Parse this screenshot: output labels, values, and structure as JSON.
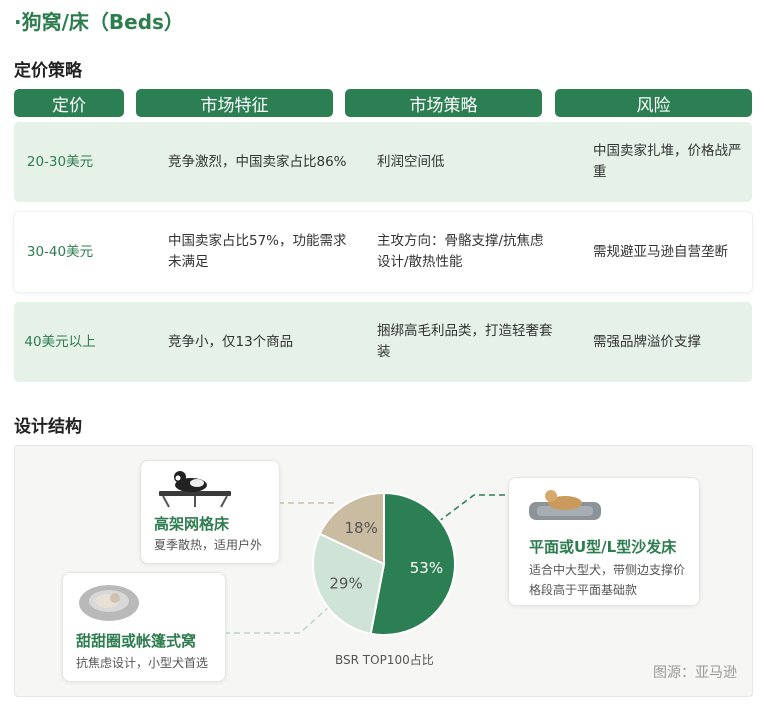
{
  "page_title": "·狗窝/床（Beds）",
  "pricing": {
    "section_title": "定价策略",
    "headers": [
      "定价",
      "市场特征",
      "市场策略",
      "风险"
    ],
    "rows": [
      {
        "price": "20-30美元",
        "feature": "竞争激烈，中国卖家占比86%",
        "strategy": "利润空间低",
        "risk": "中国卖家扎堆，价格战严重"
      },
      {
        "price": "30-40美元",
        "feature": "中国卖家占比57%，功能需求未满足",
        "strategy": "主攻方向：骨骼支撑/抗焦虑设计/散热性能",
        "risk": "需规避亚马逊自营垄断"
      },
      {
        "price": "40美元以上",
        "feature": "竞争小，仅13个商品",
        "strategy": "捆绑高毛利品类，打造轻奢套装",
        "risk": "需强品牌溢价支撑"
      }
    ]
  },
  "design": {
    "section_title": "设计结构",
    "cards": [
      {
        "title": "高架网格床",
        "desc": "夏季散热，适用户外",
        "icon": "elevated-cot-bed-photo"
      },
      {
        "title": "甜甜圈或帐篷式窝",
        "desc": "抗焦虑设计，小型犬首选",
        "icon": "donut-bed-photo"
      },
      {
        "title": "平面或U型/L型沙发床",
        "desc": "适合中大型犬，带侧边支撑价格段高于平面基础款",
        "icon": "bolster-sofa-bed-photo"
      }
    ],
    "source": "图源：亚马逊"
  },
  "chart_data": {
    "type": "pie",
    "title": "",
    "caption": "BSR TOP100占比",
    "slices": [
      {
        "label": "53%",
        "value": 53,
        "color": "#2b7f52",
        "text_color": "#ffffff"
      },
      {
        "label": "29%",
        "value": 29,
        "color": "#cfe4d6",
        "text_color": "#555555"
      },
      {
        "label": "18%",
        "value": 18,
        "color": "#c9bca0",
        "text_color": "#555555"
      }
    ],
    "slice_links": {
      "53%": "平面或U型/L型沙发床",
      "29%": "甜甜圈或帐篷式窝",
      "18%": "高架网格床"
    }
  }
}
